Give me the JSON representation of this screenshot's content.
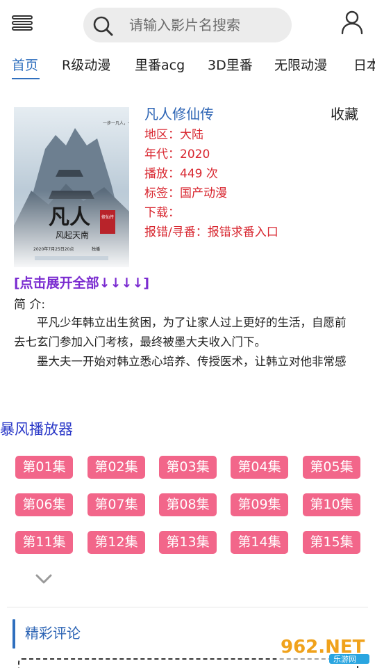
{
  "header": {
    "menu_icon": "hamburger-menu-icon",
    "search": {
      "placeholder": "请输入影片名搜索",
      "icon": "search-icon"
    },
    "user_icon": "user-icon"
  },
  "tabs": [
    {
      "label": "首页",
      "active": true
    },
    {
      "label": "R级动漫"
    },
    {
      "label": "里番acg"
    },
    {
      "label": "3D里番"
    },
    {
      "label": "无限动漫"
    },
    {
      "label": "日本"
    }
  ],
  "detail": {
    "title": "凡人修仙传",
    "favorite": "收藏",
    "poster": {
      "top_text": "一步一凡人，一念一仙途",
      "title_big": "凡人",
      "subtitle": "风起天南",
      "seal": "修仙传",
      "date": "2020年7月25日20点",
      "platform": "独播"
    },
    "rows": [
      {
        "label": "地区：",
        "value": "大陆"
      },
      {
        "label": "年代：",
        "value": "2020"
      },
      {
        "label": "播放：",
        "value": "449 次"
      },
      {
        "label": "标签：",
        "value": "国产动漫"
      },
      {
        "label": "下载：",
        "value": ""
      },
      {
        "label": "报错/寻番：",
        "value": "报错求番入口"
      }
    ],
    "expand_label": "[点击展开全部↓↓↓↓]",
    "intro_label": "简 介:",
    "intro_paragraphs": [
      "平凡少年韩立出生贫困，为了让家人过上更好的生活，自愿前去七玄门参加入门考核，最终被墨大夫收入门下。",
      "墨大夫一开始对韩立悉心培养、传授医术，让韩立对他非常感激，"
    ]
  },
  "player": {
    "name": "暴风播放器",
    "episodes": [
      "第01集",
      "第02集",
      "第03集",
      "第04集",
      "第05集",
      "第06集",
      "第07集",
      "第08集",
      "第09集",
      "第10集",
      "第11集",
      "第12集",
      "第13集",
      "第14集",
      "第15集"
    ],
    "more_icon": "chevron-down-icon"
  },
  "comments": {
    "title": "精彩评论"
  },
  "watermark": {
    "brand": "962.NET",
    "sub": "乐游网"
  },
  "colors": {
    "accent": "#2f6fbe",
    "info_red": "#d8262f",
    "episode_bg": "#f2668a",
    "expand_purple": "#7a2bd0",
    "player_title": "#2b39c8"
  }
}
